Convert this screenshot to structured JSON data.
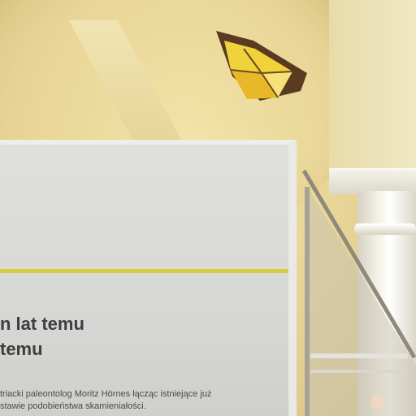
{
  "panel": {
    "heading_lines": [
      "n lat temu",
      "temu"
    ],
    "body_lines": [
      "triacki paleontolog Moritz Hörnes łącząc istniejące już",
      "stawie podobieństwa skamieniałości."
    ]
  },
  "colors": {
    "wall": "#e9d698",
    "panel": "#d7d8d5",
    "stripe": "#dccb3a",
    "lamp": "#f2d23a",
    "column": "#f4f1e7"
  }
}
